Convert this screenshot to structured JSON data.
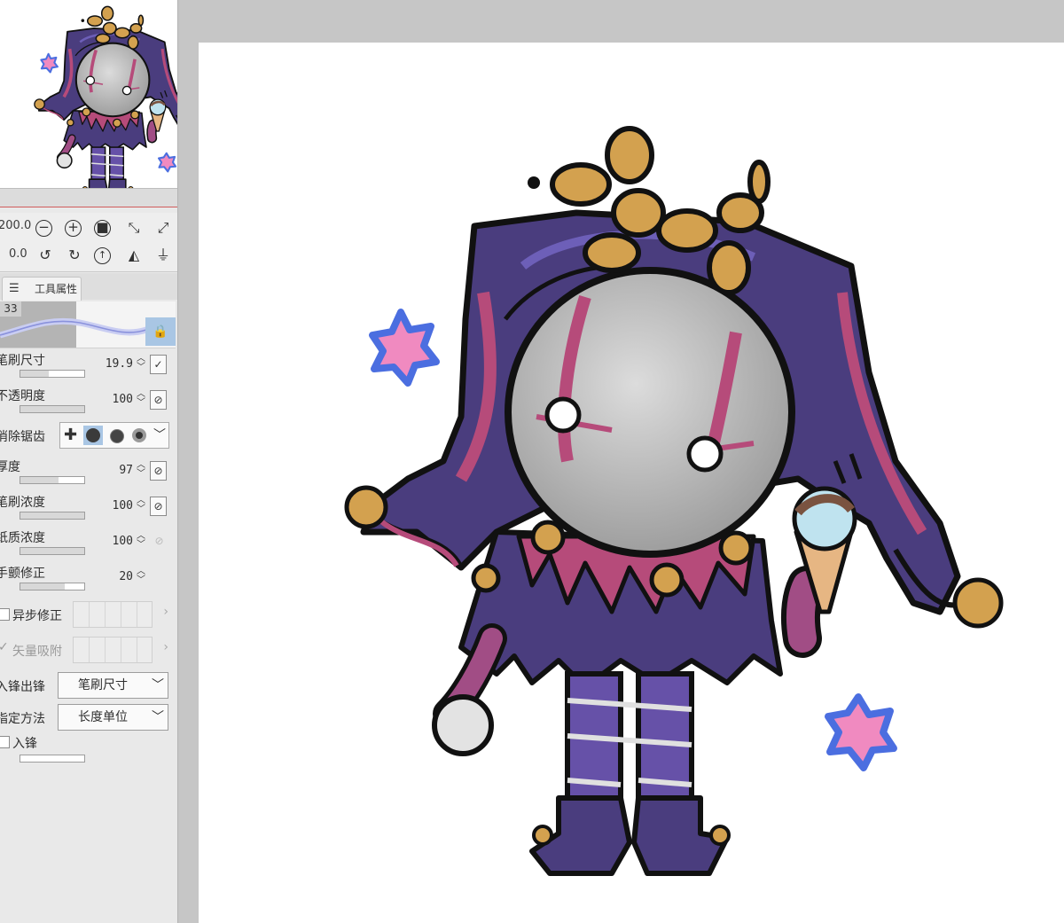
{
  "navigator": {
    "zoom_value": "200.0",
    "rotation_value": "0.0",
    "icons": [
      "zoom-out-icon",
      "zoom-in-icon",
      "fit-stop-icon",
      "fit-navigator-icon",
      "fit-window-icon",
      "rotate-left-icon",
      "rotate-right-icon",
      "reset-rotation-icon",
      "flip-horizontal-icon",
      "flip-vertical-icon"
    ]
  },
  "tool_property": {
    "tab_label": "工具属性",
    "preview_size": "33",
    "properties": [
      {
        "label": "笔刷尺寸",
        "value": "19.9",
        "level": 0.45
      },
      {
        "label": "不透明度",
        "value": "100",
        "level": 1.0
      },
      {
        "label": "消除锯齿"
      },
      {
        "label": "厚度",
        "value": "97",
        "level": 0.6
      },
      {
        "label": "笔刷浓度",
        "value": "100",
        "level": 1.0
      },
      {
        "label": "纸质浓度",
        "value": "100",
        "level": 1.0
      },
      {
        "label": "手颤修正",
        "value": "20",
        "level": 0.7
      }
    ],
    "async_label": "异步修正",
    "vector_snap_label": "矢量吸附",
    "stroke_label": "入锋出锋",
    "stroke_value": "笔刷尺寸",
    "method_label": "指定方法",
    "method_value": "长度单位",
    "entry_label": "入锋"
  },
  "colors": {
    "panel_bg": "#e9e9e9",
    "canvas_bg": "#ffffff",
    "workspace_bg": "#c6c6c6",
    "active_highlight": "#a9c6e4",
    "costume_purple": "#4a3d7e",
    "costume_pink": "#b64b7a",
    "balloon_gold": "#d3a14f",
    "star_blue": "#4b6ee0",
    "star_pink": "#f08ac0"
  }
}
